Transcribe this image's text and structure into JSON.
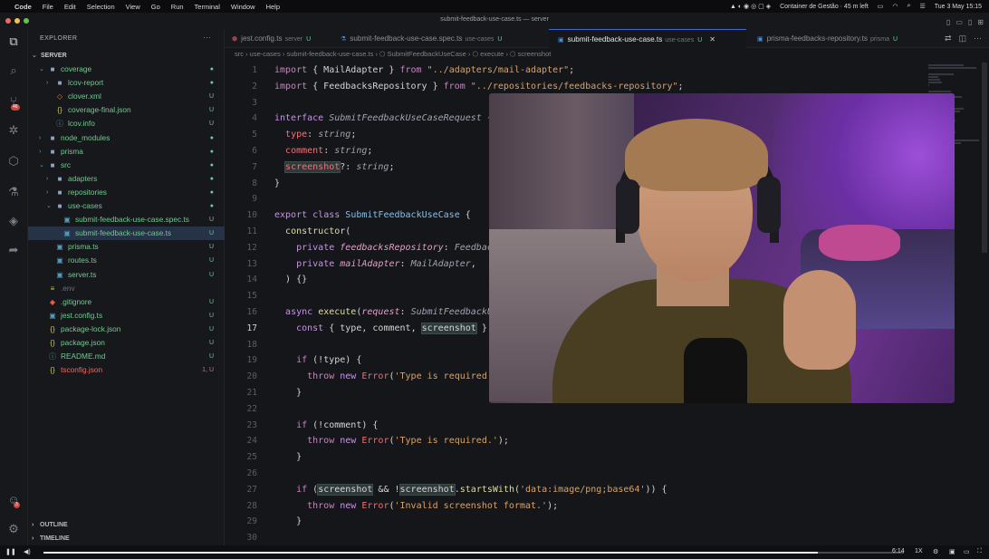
{
  "menubar": {
    "app": "Code",
    "items": [
      "File",
      "Edit",
      "Selection",
      "View",
      "Go",
      "Run",
      "Terminal",
      "Window",
      "Help"
    ],
    "calendar": "Container de Gestão · 45 m left",
    "datetime": "Tue 3 May  15:15"
  },
  "window": {
    "title": "submit-feedback-use-case.ts — server"
  },
  "activity": {
    "source_control_badge": "46",
    "account_badge": "3"
  },
  "sidebar": {
    "title": "EXPLORER",
    "root": "SERVER",
    "items": [
      {
        "name": "coverage",
        "kind": "folder-open",
        "depth": 1,
        "status": "●",
        "color": "#73c991"
      },
      {
        "name": "lcov-report",
        "kind": "folder",
        "depth": 2,
        "status": "●",
        "color": "#73c991"
      },
      {
        "name": "clover.xml",
        "kind": "file-xml",
        "depth": 2,
        "status": "U",
        "color": "#73c991"
      },
      {
        "name": "coverage-final.json",
        "kind": "file-json",
        "depth": 2,
        "status": "U",
        "color": "#73c991"
      },
      {
        "name": "lcov.info",
        "kind": "file-info",
        "depth": 2,
        "status": "U",
        "color": "#73c991"
      },
      {
        "name": "node_modules",
        "kind": "folder",
        "depth": 1,
        "status": "●",
        "color": "#73c991"
      },
      {
        "name": "prisma",
        "kind": "folder",
        "depth": 1,
        "status": "●",
        "color": "#73c991"
      },
      {
        "name": "src",
        "kind": "folder-open",
        "depth": 1,
        "status": "●",
        "color": "#73c991"
      },
      {
        "name": "adapters",
        "kind": "folder",
        "depth": 2,
        "status": "●",
        "color": "#73c991"
      },
      {
        "name": "repositories",
        "kind": "folder",
        "depth": 2,
        "status": "●",
        "color": "#73c991"
      },
      {
        "name": "use-cases",
        "kind": "folder-open",
        "depth": 2,
        "status": "●",
        "color": "#73c991"
      },
      {
        "name": "submit-feedback-use-case.spec.ts",
        "kind": "file-ts",
        "depth": 3,
        "status": "U",
        "color": "#73c991"
      },
      {
        "name": "submit-feedback-use-case.ts",
        "kind": "file-ts",
        "depth": 3,
        "status": "U",
        "color": "#73c991",
        "selected": true
      },
      {
        "name": "prisma.ts",
        "kind": "file-ts",
        "depth": 2,
        "status": "U",
        "color": "#73c991"
      },
      {
        "name": "routes.ts",
        "kind": "file-ts",
        "depth": 2,
        "status": "U",
        "color": "#73c991"
      },
      {
        "name": "server.ts",
        "kind": "file-ts",
        "depth": 2,
        "status": "U",
        "color": "#73c991"
      },
      {
        "name": ".env",
        "kind": "file-env",
        "depth": 1,
        "status": "",
        "color": "#6b6f77"
      },
      {
        "name": ".gitignore",
        "kind": "file-git",
        "depth": 1,
        "status": "U",
        "color": "#73c991"
      },
      {
        "name": "jest.config.ts",
        "kind": "file-ts",
        "depth": 1,
        "status": "U",
        "color": "#73c991"
      },
      {
        "name": "package-lock.json",
        "kind": "file-json",
        "depth": 1,
        "status": "U",
        "color": "#73c991"
      },
      {
        "name": "package.json",
        "kind": "file-json",
        "depth": 1,
        "status": "U",
        "color": "#73c991"
      },
      {
        "name": "README.md",
        "kind": "file-info",
        "depth": 1,
        "status": "U",
        "color": "#73c991"
      },
      {
        "name": "tsconfig.json",
        "kind": "file-json",
        "depth": 1,
        "status": "1, U",
        "color": "#e46c6c"
      }
    ],
    "outline": "OUTLINE",
    "timeline": "TIMELINE"
  },
  "tabs": [
    {
      "name": "jest.config.ts",
      "sub": "server",
      "mark": "U",
      "active": false
    },
    {
      "name": "submit-feedback-use-case.spec.ts",
      "sub": "use-cases",
      "mark": "U",
      "active": false
    },
    {
      "name": "submit-feedback-use-case.ts",
      "sub": "use-cases",
      "mark": "U",
      "active": true
    },
    {
      "name": "prisma-feedbacks-repository.ts",
      "sub": "prisma",
      "mark": "U",
      "active": false
    }
  ],
  "breadcrumb": "src › use-cases › submit-feedback-use-case.ts › ⬡ SubmitFeedbackUseCase › ⬡ execute › ⬡ screenshot",
  "editor": {
    "current_line": 17,
    "lines": [
      {
        "n": "1",
        "html": "<span class='kb'>import</span> { MailAdapter } <span class='kb'>from</span> <span class='s'>\"../adapters/mail-adapter\"</span>;"
      },
      {
        "n": "2",
        "html": "<span class='kb'>import</span> { FeedbacksRepository } <span class='kb'>from</span> <span class='s'>\"../repositories/feedbacks-repository\"</span>;"
      },
      {
        "n": "3",
        "html": ""
      },
      {
        "n": "4",
        "html": "<span class='k'>interface</span> <span class='t'>SubmitFeedbackUseCaseRequest</span> {"
      },
      {
        "n": "5",
        "html": "  <span class='p'>type</span>: <span class='t'>string</span>;"
      },
      {
        "n": "6",
        "html": "  <span class='p'>comment</span>: <span class='t'>string</span>;"
      },
      {
        "n": "7",
        "html": "  <span class='hl'><span class='p'>screenshot</span></span>?: <span class='t'>string</span>;"
      },
      {
        "n": "8",
        "html": "}"
      },
      {
        "n": "9",
        "html": ""
      },
      {
        "n": "10",
        "html": "<span class='k'>export</span> <span class='k'>class</span> <span class='cl'>SubmitFeedbackUseCase</span> {"
      },
      {
        "n": "11",
        "html": "  <span class='f'>constructor</span>("
      },
      {
        "n": "12",
        "html": "    <span class='k'>private</span> <span class='v'>feedbacksRepository</span>: <span class='t'>FeedbacksRepository</span>,"
      },
      {
        "n": "13",
        "html": "    <span class='k'>private</span> <span class='v'>mailAdapter</span>: <span class='t'>MailAdapter</span>,"
      },
      {
        "n": "14",
        "html": "  ) {}"
      },
      {
        "n": "15",
        "html": ""
      },
      {
        "n": "16",
        "html": "  <span class='k'>async</span> <span class='f'>execute</span>(<span class='v'>request</span>: <span class='t'>SubmitFeedbackUseCaseRequest</span>) {"
      },
      {
        "n": "17",
        "html": "    <span class='k'>const</span> { <span class='w'>type</span>, <span class='w'>comment</span>, <span class='hl'>screenshot</span> } = request;"
      },
      {
        "n": "18",
        "html": ""
      },
      {
        "n": "19",
        "html": "    <span class='kb'>if</span> (!<span class='w'>type</span>) {"
      },
      {
        "n": "20",
        "html": "      <span class='kb'>throw</span> <span class='k'>new</span> <span class='e'>Error</span>(<span class='s'>'Type is required.'</span>);"
      },
      {
        "n": "21",
        "html": "    }"
      },
      {
        "n": "22",
        "html": ""
      },
      {
        "n": "23",
        "html": "    <span class='kb'>if</span> (!<span class='w'>comment</span>) {"
      },
      {
        "n": "24",
        "html": "      <span class='kb'>throw</span> <span class='k'>new</span> <span class='e'>Error</span>(<span class='s'>'Type is required.'</span>);"
      },
      {
        "n": "25",
        "html": "    }"
      },
      {
        "n": "26",
        "html": ""
      },
      {
        "n": "27",
        "html": "    <span class='kb'>if</span> (<span class='hl'>screenshot</span> &amp;&amp; !<span class='hl'>screenshot</span>.<span class='f'>startsWith</span>(<span class='s'>'data:image/png;base64'</span>)) {"
      },
      {
        "n": "28",
        "html": "      <span class='kb'>throw</span> <span class='k'>new</span> <span class='e'>Error</span>(<span class='s'>'Invalid screenshot format.'</span>);"
      },
      {
        "n": "29",
        "html": "    }"
      },
      {
        "n": "30",
        "html": ""
      }
    ]
  },
  "player": {
    "time": "6:14",
    "speed": "1X",
    "progress": 0.9
  }
}
